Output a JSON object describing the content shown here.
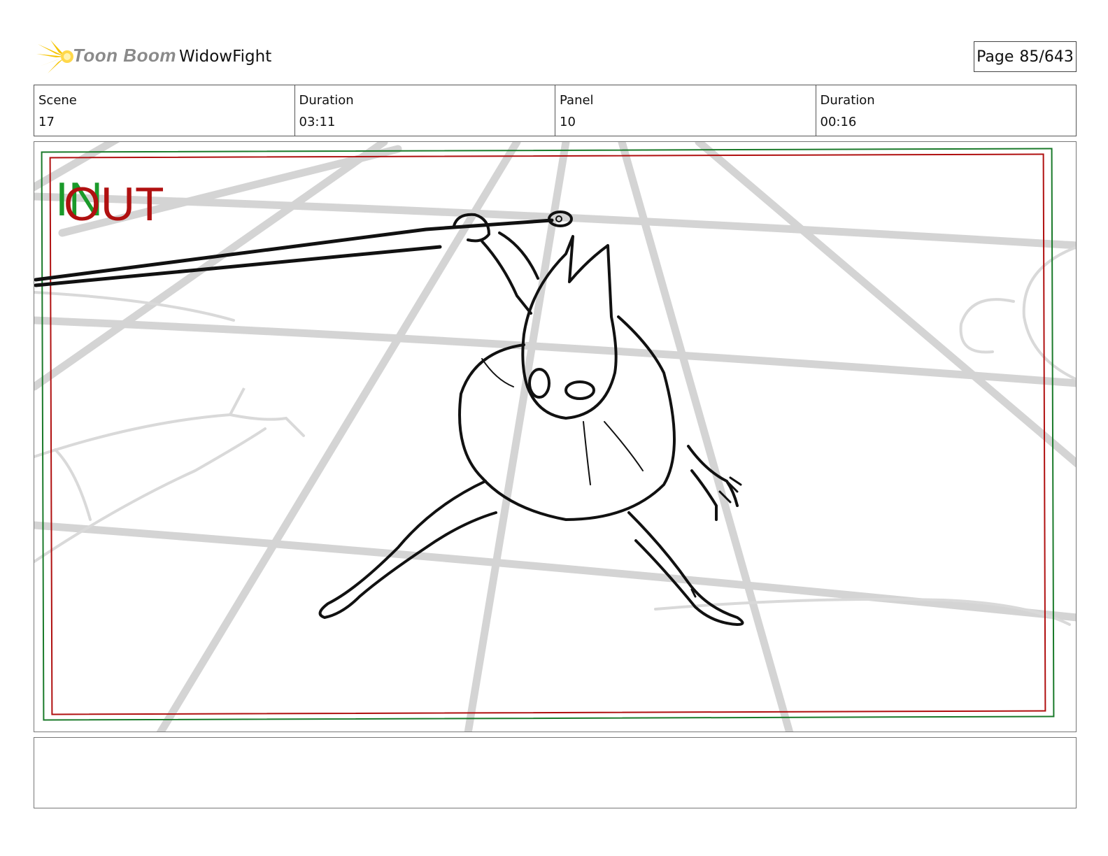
{
  "header": {
    "brand": "Toon Boom",
    "project_title": "WidowFight",
    "page_label": "Page",
    "page_value": "85/643"
  },
  "info": {
    "scene_label": "Scene",
    "scene_value": "17",
    "scene_duration_label": "Duration",
    "scene_duration_value": "03:11",
    "panel_label": "Panel",
    "panel_value": "10",
    "panel_duration_label": "Duration",
    "panel_duration_value": "00:16"
  },
  "frame": {
    "in_label": "IN",
    "out_label": "OUT"
  },
  "notes": {
    "text": ""
  },
  "colors": {
    "in_green": "#1a9a2a",
    "out_red": "#b01010",
    "logo_yellow": "#f5c400"
  }
}
